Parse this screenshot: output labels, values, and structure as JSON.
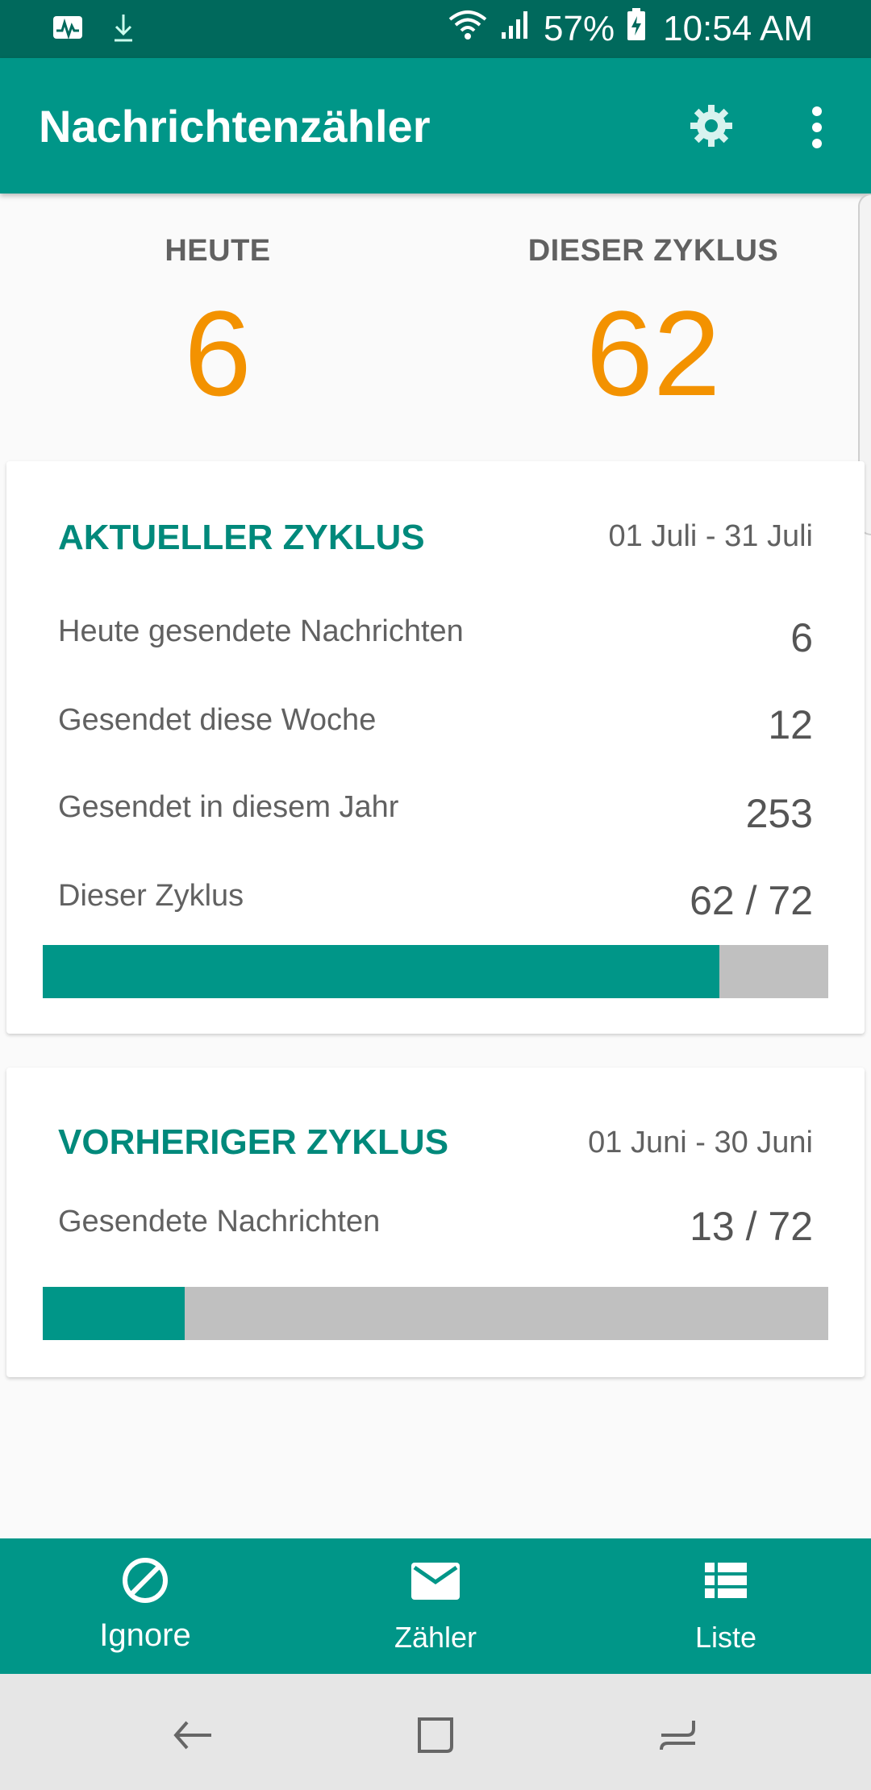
{
  "status_bar": {
    "battery": "57%",
    "time": "10:54 AM",
    "icons": [
      "activity-icon",
      "download-icon",
      "wifi-icon",
      "signal-icon",
      "battery-icon"
    ]
  },
  "app_bar": {
    "title": "Nachrichtenzähler",
    "actions": [
      "settings-gear-icon",
      "more-vert-icon"
    ]
  },
  "summary": {
    "today_label": "HEUTE",
    "today_value": "6",
    "cycle_label": "DIESER ZYKLUS",
    "cycle_value": "62"
  },
  "current_cycle": {
    "title": "AKTUELLER ZYKLUS",
    "range": "01 Juli - 31 Juli",
    "rows": [
      {
        "label": "Heute gesendete Nachrichten",
        "value": "6"
      },
      {
        "label": "Gesendet diese Woche",
        "value": "12"
      },
      {
        "label": "Gesendet in diesem Jahr",
        "value": "253"
      },
      {
        "label": "Dieser Zyklus",
        "value": "62 / 72"
      }
    ],
    "progress": 0.861
  },
  "previous_cycle": {
    "title": "VORHERIGER ZYKLUS",
    "range": "01 Juni - 30 Juni",
    "rows": [
      {
        "label": "Gesendete Nachrichten",
        "value": "13 / 72"
      }
    ],
    "progress": 0.181
  },
  "bottom_nav": {
    "items": [
      {
        "label": "Ignore",
        "icon": "block-icon"
      },
      {
        "label": "Zähler",
        "icon": "mail-icon"
      },
      {
        "label": "Liste",
        "icon": "list-icon"
      }
    ],
    "active": 0
  },
  "colors": {
    "primary": "#009688",
    "primary_dark": "#00695c",
    "accent_number": "#f39200",
    "card_title": "#00897b",
    "progress_track": "#c0c0c0"
  }
}
